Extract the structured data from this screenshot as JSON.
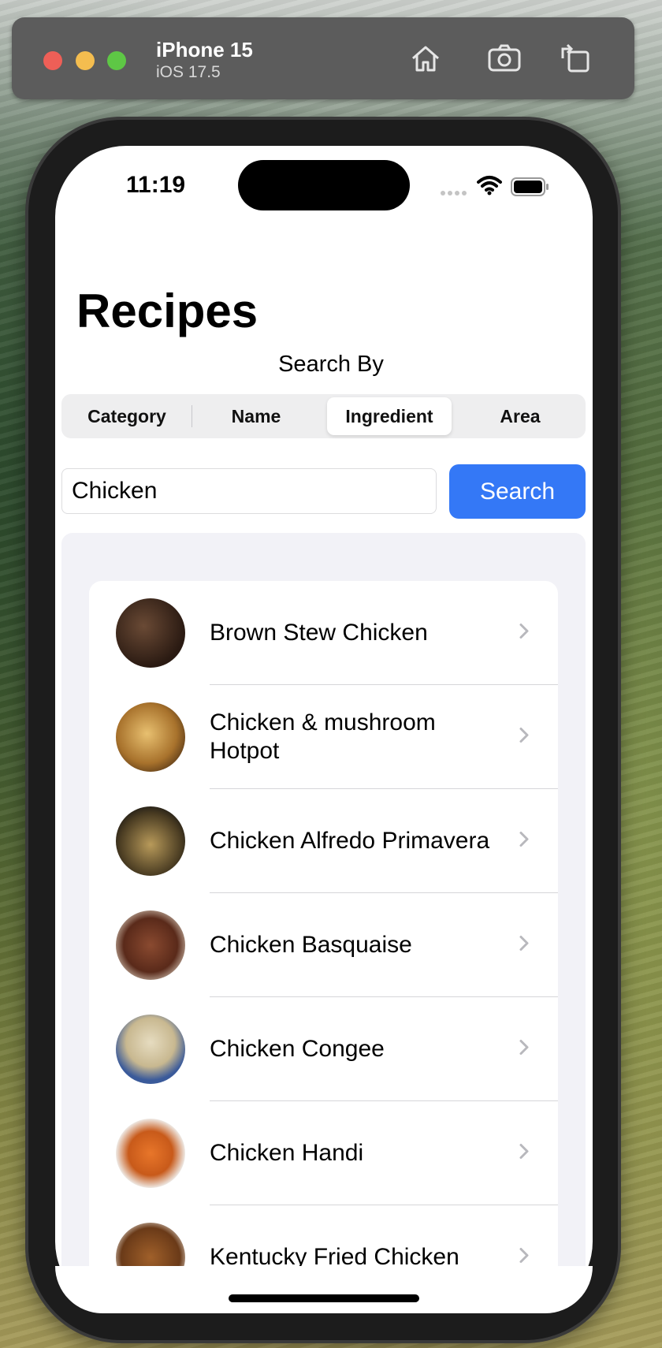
{
  "simulator": {
    "device_name": "iPhone 15",
    "os_version": "iOS 17.5"
  },
  "status_bar": {
    "time": "11:19"
  },
  "page": {
    "title": "Recipes",
    "search_by_label": "Search By"
  },
  "segmented_control": {
    "options": [
      "Category",
      "Name",
      "Ingredient",
      "Area"
    ],
    "selected": "Ingredient"
  },
  "search": {
    "value": "Chicken",
    "button_label": "Search"
  },
  "results": [
    {
      "name": "Brown Stew Chicken"
    },
    {
      "name": "Chicken & mushroom Hotpot"
    },
    {
      "name": "Chicken Alfredo Primavera"
    },
    {
      "name": "Chicken Basquaise"
    },
    {
      "name": "Chicken Congee"
    },
    {
      "name": "Chicken Handi"
    },
    {
      "name": "Kentucky Fried Chicken"
    }
  ],
  "colors": {
    "accent": "#3478f6",
    "list_background": "#f2f2f7"
  }
}
